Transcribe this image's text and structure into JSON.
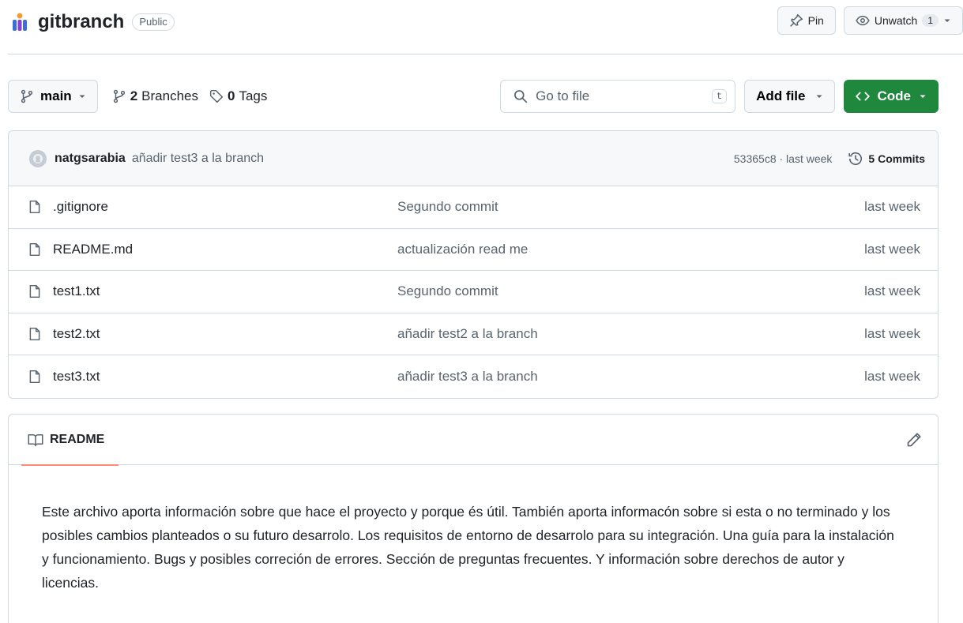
{
  "repo": {
    "name": "gitbranch",
    "visibility": "Public"
  },
  "header_actions": {
    "pin_label": "Pin",
    "unwatch_label": "Unwatch",
    "watch_count": "1"
  },
  "toolbar": {
    "branch": "main",
    "branches_count": "2",
    "branches_label": "Branches",
    "tags_count": "0",
    "tags_label": "Tags",
    "search_placeholder": "Go to file",
    "search_shortcut": "t",
    "add_file_label": "Add file",
    "code_label": "Code"
  },
  "latest_commit": {
    "author": "natgsarabia",
    "message": "añadir test3 a la branch",
    "hash_time": "53365c8 · last week",
    "commits_label": "5 Commits"
  },
  "files": [
    {
      "name": ".gitignore",
      "commit": "Segundo commit",
      "time": "last week"
    },
    {
      "name": "README.md",
      "commit": "actualización read me",
      "time": "last week"
    },
    {
      "name": "test1.txt",
      "commit": "Segundo commit",
      "time": "last week"
    },
    {
      "name": "test2.txt",
      "commit": "añadir test2 a la branch",
      "time": "last week"
    },
    {
      "name": "test3.txt",
      "commit": "añadir test3 a la branch",
      "time": "last week"
    }
  ],
  "readme": {
    "tab_label": "README",
    "body": "Este archivo aporta información sobre que hace el proyecto y porque és útil. También aporta informacón sobre si esta o no terminado y los posibles cambios planteados o su futuro desarrolo. Los requisitos de entorno de desarrolo para su integración. Una guía para la instalación y funcionamiento. Bugs y posibles correción de errores. Sección de preguntas frecuentes. Y información sobre derechos de autor y licencias."
  },
  "colors": {
    "accent_green": "#1f883d",
    "tab_underline": "#fd8c73",
    "border": "#d1d9e0"
  }
}
